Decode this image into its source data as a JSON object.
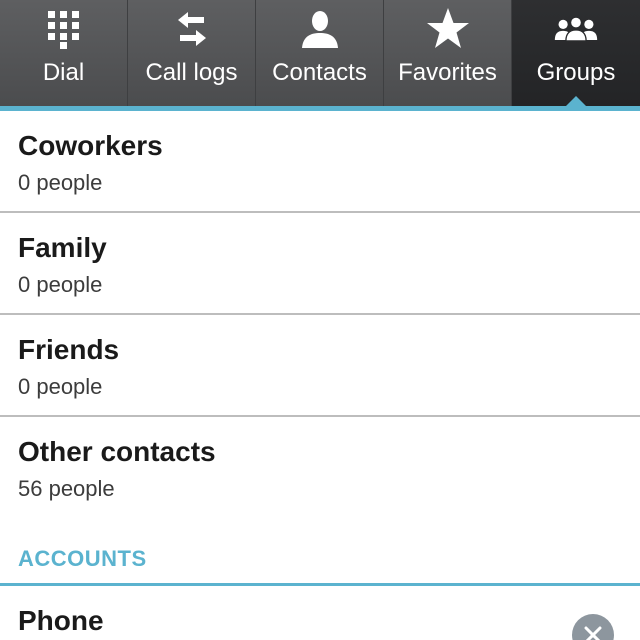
{
  "tabs": [
    {
      "label": "Dial",
      "icon": "dialpad-icon",
      "active": false
    },
    {
      "label": "Call logs",
      "icon": "call-logs-icon",
      "active": false
    },
    {
      "label": "Contacts",
      "icon": "contact-person-icon",
      "active": false
    },
    {
      "label": "Favorites",
      "icon": "star-icon",
      "active": false
    },
    {
      "label": "Groups",
      "icon": "groups-icon",
      "active": true
    }
  ],
  "groups": [
    {
      "name": "Coworkers",
      "count": "0 people"
    },
    {
      "name": "Family",
      "count": "0 people"
    },
    {
      "name": "Friends",
      "count": "0 people"
    },
    {
      "name": "Other contacts",
      "count": "56 people"
    }
  ],
  "accounts_section": {
    "title": "ACCOUNTS"
  },
  "accounts": [
    {
      "name": "Phone",
      "expand_icon": "collapse-icon"
    }
  ],
  "colors": {
    "accent": "#5bb3cf",
    "tabbar": "#545557",
    "tab_active": "#2b2c2e",
    "text_primary": "#1a1a1a",
    "divider": "#bdbdbd"
  }
}
